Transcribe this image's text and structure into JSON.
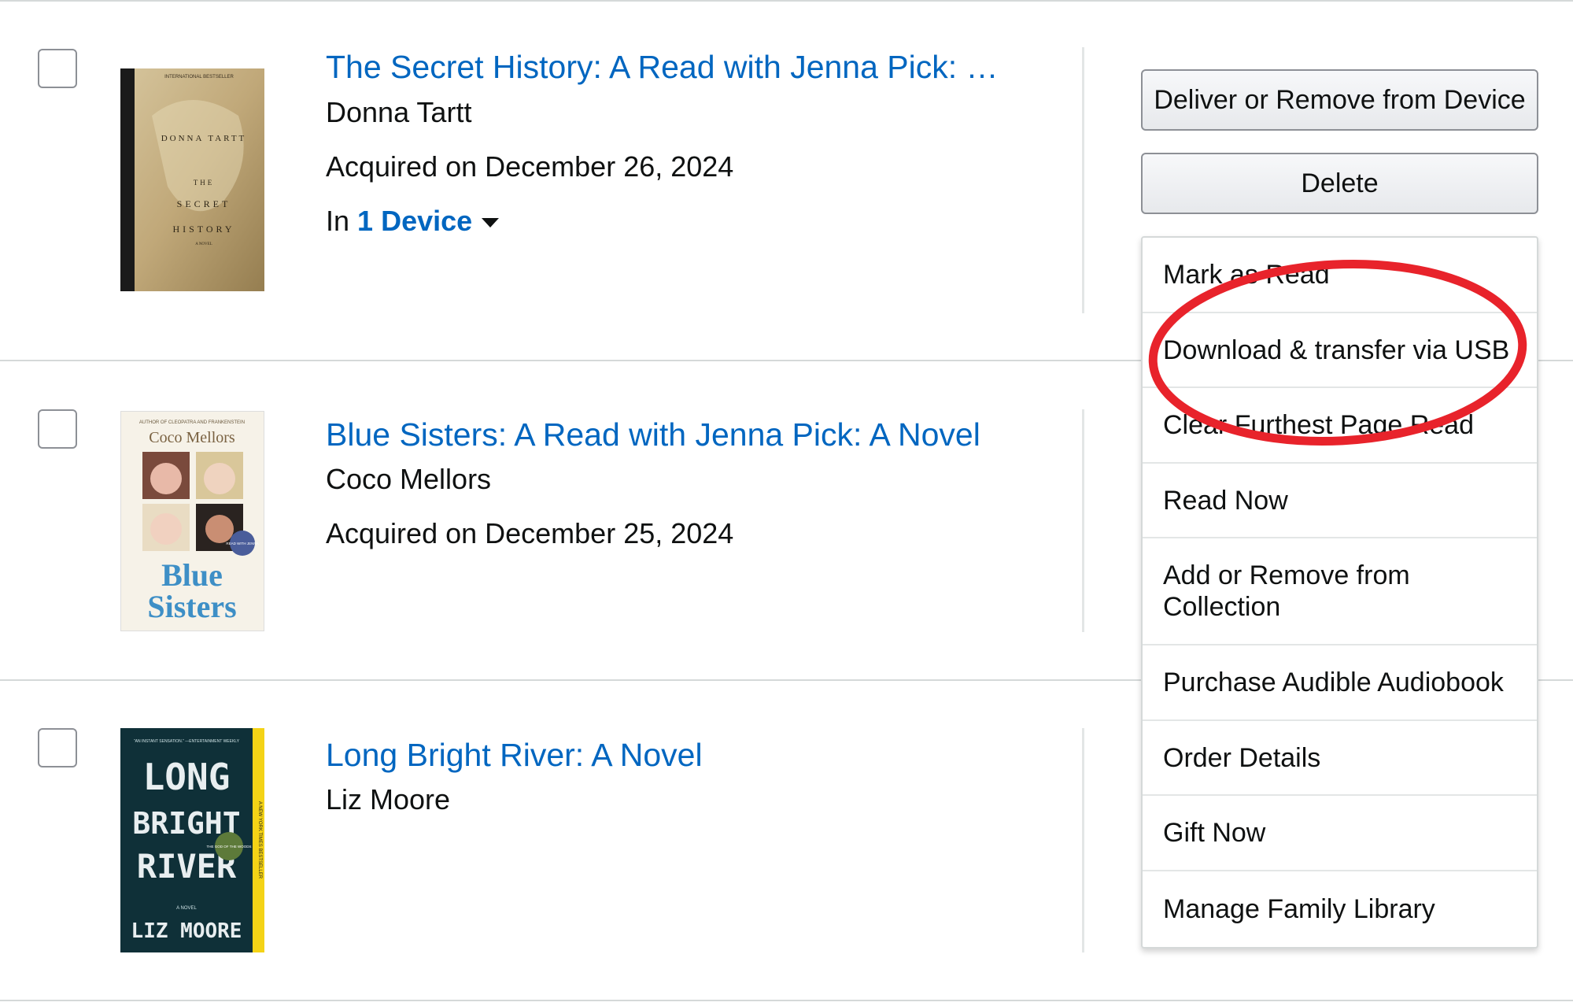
{
  "books": [
    {
      "title": "The Secret History: A Read with Jenna Pick: …",
      "author": "Donna Tartt",
      "acquired": "Acquired on December 26, 2024",
      "device_prefix": "In",
      "device_link": "1 Device",
      "cover": {
        "top_label": "INTERNATIONAL BESTSELLER",
        "author_text": "DONNA TARTT",
        "title_line1": "THE",
        "title_line2": "SECRET",
        "title_line3": "HISTORY",
        "subtitle": "A NOVEL",
        "colors": {
          "background": "#c8b48a",
          "spine": "#1a1a1a"
        }
      }
    },
    {
      "title": "Blue Sisters: A Read with Jenna Pick: A Novel",
      "author": "Coco Mellors",
      "acquired": "Acquired on December 25, 2024",
      "cover": {
        "top_label": "AUTHOR OF CLEOPATRA AND FRANKENSTEIN",
        "author_text": "Coco Mellors",
        "title_line1": "Blue",
        "title_line2": "Sisters",
        "badge": "READ WITH JENNA",
        "colors": {
          "background": "#f6f2e8",
          "title": "#3e8fc6"
        }
      }
    },
    {
      "title": "Long Bright River: A Novel",
      "author": "Liz Moore",
      "cover": {
        "top_label": "“AN INSTANT SENSATION.” —ENTERTAINMENT WEEKLY",
        "title_line1": "LONG",
        "title_line2": "BRIGHT",
        "title_line3": "RIVER",
        "subtitle": "A NOVEL",
        "author_text": "LIZ MOORE",
        "side_text": "A NEW YORK TIMES BESTSELLER",
        "badge": "THE GOD OF THE WOODS",
        "colors": {
          "background": "#0f3038",
          "stripe": "#f4d316"
        }
      }
    }
  ],
  "actions": {
    "deliver_label": "Deliver or Remove from Device",
    "delete_label": "Delete"
  },
  "menu_items": [
    "Mark as Read",
    "Download & transfer via USB",
    "Clear Furthest Page Read",
    "Read Now",
    "Add or Remove from Collection",
    "Purchase Audible Audiobook",
    "Order Details",
    "Gift Now",
    "Manage Family Library"
  ],
  "colors": {
    "link": "#0066c0",
    "text": "#0f1111",
    "annotation": "#e8232b",
    "divider": "#d5d9d9"
  }
}
